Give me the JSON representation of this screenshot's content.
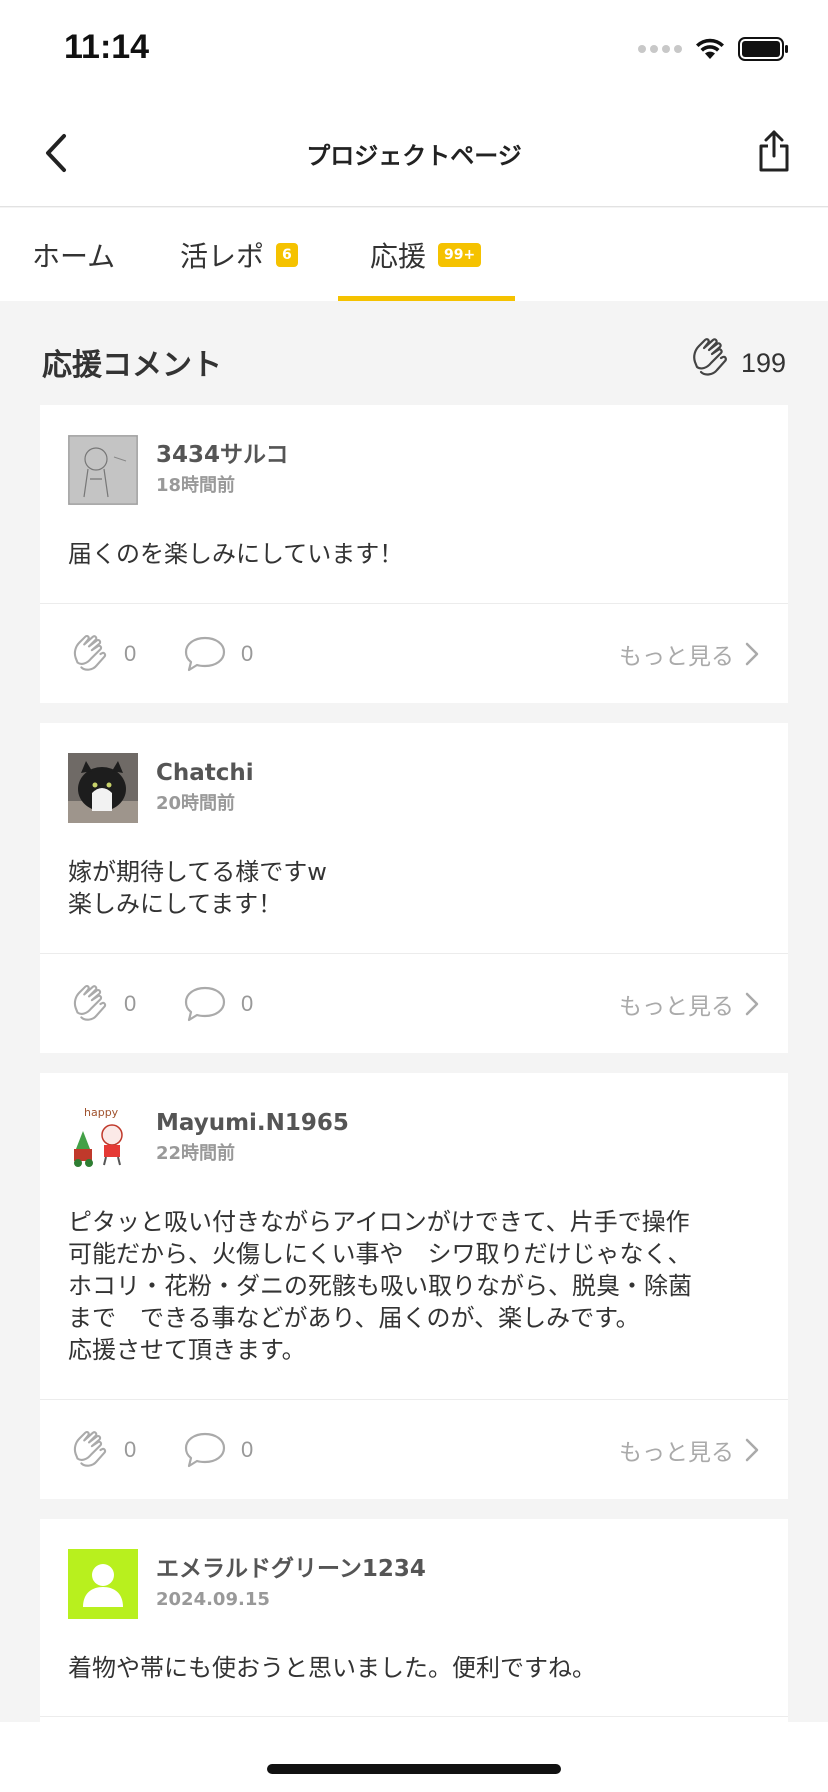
{
  "status": {
    "time": "11:14"
  },
  "nav": {
    "title": "プロジェクトページ"
  },
  "tabs": [
    {
      "label": "ホーム",
      "badge": ""
    },
    {
      "label": "活レポ",
      "badge": "6"
    },
    {
      "label": "応援",
      "badge": "99+"
    }
  ],
  "active_tab": "応援",
  "section": {
    "title": "応援コメント",
    "clap_count": "199"
  },
  "comments": [
    {
      "user": "3434サルコ",
      "time": "18時間前",
      "text": "届くのを楽しみにしています！",
      "claps": "0",
      "replies": "0",
      "more": "もっと見る"
    },
    {
      "user": "Chatchi",
      "time": "20時間前",
      "text": "嫁が期待してる様ですw\n楽しみにしてます！",
      "claps": "0",
      "replies": "0",
      "more": "もっと見る"
    },
    {
      "user": "Mayumi.N1965",
      "time": "22時間前",
      "avatar_text": "happy",
      "text": "ピタッと吸い付きながらアイロンがけできて、片手で操作\n可能だから、火傷しにくい事や　シワ取りだけじゃなく、\nホコリ・花粉・ダニの死骸も吸い取りながら、脱臭・除菌\nまで　できる事などがあり、届くのが、楽しみです。\n応援させて頂きます。",
      "claps": "0",
      "replies": "0",
      "more": "もっと見る"
    },
    {
      "user": "エメラルドグリーン1234",
      "time": "2024.09.15",
      "text": "着物や帯にも使おうと思いました。便利ですね。"
    }
  ],
  "colors": {
    "accent": "#f5c200",
    "default_avatar": "#b8f01e"
  }
}
